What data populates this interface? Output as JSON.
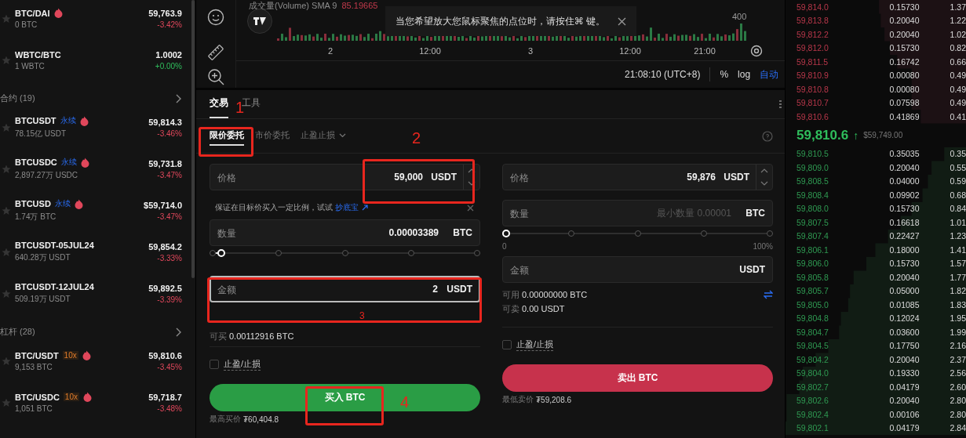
{
  "market_list": {
    "sections": [
      {
        "items": [
          {
            "pair": "BTC/DAI",
            "hot": true,
            "volume": "0 BTC",
            "price": "59,763.9",
            "change": "-3.42%",
            "negative": true
          },
          {
            "pair": "WBTC/BTC",
            "hot": false,
            "volume": "1 WBTC",
            "price": "1.0002",
            "change": "+0.00%",
            "negative": false
          }
        ]
      },
      {
        "title": "合约 (19)",
        "items": [
          {
            "pair": "BTCUSDT",
            "tag": {
              "text": "永续",
              "kind": "perpetual"
            },
            "hot": true,
            "volume": "78.15亿 USDT",
            "price": "59,814.3",
            "change": "-3.46%",
            "negative": true
          },
          {
            "pair": "BTCUSDC",
            "tag": {
              "text": "永续",
              "kind": "perpetual"
            },
            "hot": true,
            "volume": "2,897.27万 USDC",
            "price": "59,731.8",
            "change": "-3.47%",
            "negative": true
          },
          {
            "pair": "BTCUSD",
            "tag": {
              "text": "永续",
              "kind": "perpetual"
            },
            "hot": true,
            "volume": "1.74万 BTC",
            "price": "$59,714.0",
            "change": "-3.47%",
            "negative": true
          },
          {
            "pair": "BTCUSDT-05JUL24",
            "hot": false,
            "volume": "640.28万 USDT",
            "price": "59,854.2",
            "change": "-3.33%",
            "negative": true
          },
          {
            "pair": "BTCUSDT-12JUL24",
            "hot": false,
            "volume": "509.19万 USDT",
            "price": "59,892.5",
            "change": "-3.39%",
            "negative": true
          }
        ]
      },
      {
        "title": "杠杆 (28)",
        "items": [
          {
            "pair": "BTC/USDT",
            "tag": {
              "text": "10x",
              "kind": "leverage"
            },
            "hot": true,
            "volume": "9,153 BTC",
            "price": "59,810.6",
            "change": "-3.45%",
            "negative": true
          },
          {
            "pair": "BTC/USDC",
            "tag": {
              "text": "10x",
              "kind": "leverage"
            },
            "hot": true,
            "volume": "1,051 BTC",
            "price": "59,718.7",
            "change": "-3.48%",
            "negative": true
          }
        ]
      }
    ]
  },
  "chart": {
    "volume_legend": {
      "label": "成交量(Volume) SMA 9",
      "value": "85.19665"
    },
    "tooltip": "当您希望放大您鼠标聚焦的点位时，请按住⌘ 键。",
    "y_label": "400",
    "x_labels": [
      "2",
      "12:00",
      "3",
      "12:00",
      "21:00"
    ],
    "clock": "21:08:10 (UTC+8)",
    "scale_options": [
      {
        "label": "%",
        "selected": false
      },
      {
        "label": "log",
        "selected": false
      },
      {
        "label": "自动",
        "selected": true
      }
    ]
  },
  "trade": {
    "tabs": [
      {
        "label": "交易",
        "selected": true
      },
      {
        "label": "工具",
        "selected": false
      }
    ],
    "order_types": [
      {
        "label": "限价委托",
        "selected": true,
        "dropdown": false
      },
      {
        "label": "市价委托",
        "selected": false,
        "dropdown": false
      },
      {
        "label": "止盈止损",
        "selected": false,
        "dropdown": true
      }
    ],
    "columns": [
      {
        "kind": "buy",
        "rows": [
          {
            "kind": "stepper",
            "label": "价格",
            "value": "59,000",
            "unit": "USDT"
          },
          {
            "kind": "hint",
            "text": "保证在目标价买入一定比例，试试",
            "link": "抄底宝"
          },
          {
            "kind": "field",
            "label": "数量",
            "value": "0.00003389",
            "unit": "BTC",
            "focused": false
          },
          {
            "kind": "slider",
            "level": 0.03
          },
          {
            "kind": "field",
            "label": "金额",
            "value": "2",
            "unit": "USDT",
            "focused": true
          },
          {
            "kind": "balance",
            "label": "可买",
            "value": "0.00112916 BTC",
            "swap": false
          },
          {
            "kind": "checkbox",
            "label": "止盈/止损",
            "checked": false
          },
          {
            "kind": "button",
            "label": "买入 BTC"
          },
          {
            "kind": "note",
            "label": "最高买价",
            "value": "₮60,404.8"
          }
        ]
      },
      {
        "kind": "sell",
        "rows": [
          {
            "kind": "stepper",
            "label": "价格",
            "value": "59,876",
            "unit": "USDT"
          },
          {
            "kind": "field",
            "label": "数量",
            "placeholder": "最小数量 0.00001",
            "unit": "BTC",
            "focused": false
          },
          {
            "kind": "slider",
            "level": 0,
            "min_label": "0",
            "max_label": "100%"
          },
          {
            "kind": "field",
            "label": "金额",
            "unit": "USDT",
            "focused": false
          },
          {
            "kind": "balance",
            "label": "可用",
            "value": "0.00000000 BTC",
            "swap": true
          },
          {
            "kind": "balance",
            "label": "可卖",
            "value": "0.00 USDT",
            "swap": false
          },
          {
            "kind": "checkbox",
            "label": "止盈/止损",
            "checked": false
          },
          {
            "kind": "button",
            "label": "卖出 BTC"
          },
          {
            "kind": "note",
            "label": "最低卖价",
            "value": "₮59,208.6"
          }
        ]
      }
    ],
    "annotations": [
      {
        "label": "1"
      },
      {
        "label": "2"
      },
      {
        "label": "3"
      },
      {
        "label": "4"
      }
    ]
  },
  "order_book": {
    "asks": [
      {
        "price": "59,814.0",
        "amount": "0.15730",
        "total": "1.37"
      },
      {
        "price": "59,813.8",
        "amount": "0.20040",
        "total": "1.22"
      },
      {
        "price": "59,812.2",
        "amount": "0.20040",
        "total": "1.02"
      },
      {
        "price": "59,812.0",
        "amount": "0.15730",
        "total": "0.82"
      },
      {
        "price": "59,811.5",
        "amount": "0.16742",
        "total": "0.66"
      },
      {
        "price": "59,810.9",
        "amount": "0.00080",
        "total": "0.49"
      },
      {
        "price": "59,810.8",
        "amount": "0.00080",
        "total": "0.49"
      },
      {
        "price": "59,810.7",
        "amount": "0.07598",
        "total": "0.49"
      },
      {
        "price": "59,810.6",
        "amount": "0.41869",
        "total": "0.41"
      }
    ],
    "last": {
      "price": "59,810.6",
      "arrow": "↑",
      "index_price": "$59,749.00"
    },
    "bids": [
      {
        "price": "59,810.5",
        "amount": "0.35035",
        "total": "0.35"
      },
      {
        "price": "59,809.0",
        "amount": "0.20040",
        "total": "0.55"
      },
      {
        "price": "59,808.5",
        "amount": "0.04000",
        "total": "0.59"
      },
      {
        "price": "59,808.4",
        "amount": "0.09902",
        "total": "0.68"
      },
      {
        "price": "59,808.0",
        "amount": "0.15730",
        "total": "0.84"
      },
      {
        "price": "59,807.5",
        "amount": "0.16618",
        "total": "1.01"
      },
      {
        "price": "59,807.4",
        "amount": "0.22427",
        "total": "1.23"
      },
      {
        "price": "59,806.1",
        "amount": "0.18000",
        "total": "1.41"
      },
      {
        "price": "59,806.0",
        "amount": "0.15730",
        "total": "1.57"
      },
      {
        "price": "59,805.8",
        "amount": "0.20040",
        "total": "1.77"
      },
      {
        "price": "59,805.7",
        "amount": "0.05000",
        "total": "1.82"
      },
      {
        "price": "59,805.0",
        "amount": "0.01085",
        "total": "1.83"
      },
      {
        "price": "59,804.8",
        "amount": "0.12024",
        "total": "1.95"
      },
      {
        "price": "59,804.7",
        "amount": "0.03600",
        "total": "1.99"
      },
      {
        "price": "59,804.5",
        "amount": "0.17750",
        "total": "2.16"
      },
      {
        "price": "59,804.2",
        "amount": "0.20040",
        "total": "2.37"
      },
      {
        "price": "59,804.0",
        "amount": "0.19330",
        "total": "2.56"
      },
      {
        "price": "59,802.7",
        "amount": "0.04179",
        "total": "2.60"
      },
      {
        "price": "59,802.6",
        "amount": "0.20040",
        "total": "2.80"
      },
      {
        "price": "59,802.4",
        "amount": "0.00106",
        "total": "2.80"
      },
      {
        "price": "59,802.1",
        "amount": "0.04179",
        "total": "2.84"
      }
    ]
  }
}
